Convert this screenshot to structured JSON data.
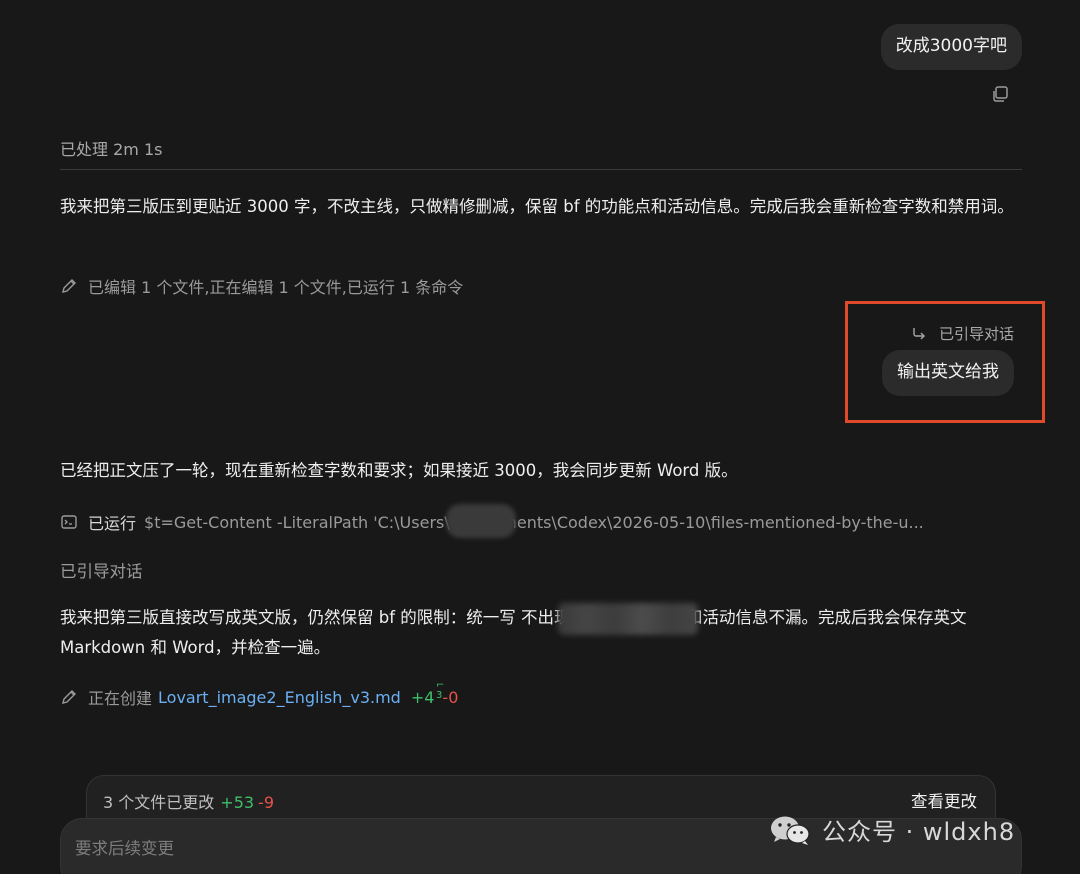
{
  "conversation": {
    "user_message_1": "改成3000字吧",
    "processed_label": "已处理 2m 1s",
    "assistant_para_1": "我来把第三版压到更贴近 3000 字，不改主线，只做精修删减，保留 bf 的功能点和活动信息。完成后我会重新检查字数和禁用词。",
    "activity_1": "已编辑 1 个文件,正在编辑 1 个文件,已运行 1 条命令",
    "steer_tag": "已引导对话",
    "user_message_2": "输出英文给我",
    "assistant_para_2": "已经把正文压了一轮，现在重新检查字数和要求；如果接近 3000，我会同步更新 Word 版。",
    "activity_2_label": "已运行",
    "activity_2_command": "$t=Get-Content -LiteralPath 'C:\\Users\\            \\Documents\\Codex\\2026-05-10\\files-mentioned-by-the-u...",
    "steer_label_2": "已引导对话",
    "assistant_para_3": "我来把第三版直接改写成英文版，仍然保留 bf 的限制：统一写                       不出现禁用词，功能点和活动信息不漏。完成后我会保存英文 Markdown 和 Word，并检查一遍。",
    "activity_3_label": "正在创建",
    "activity_3_file": "Lovart_image2_English_v3.md",
    "activity_3_plus": "+4",
    "activity_3_spin": "⌐\n3",
    "activity_3_minus": "-0"
  },
  "changes_bar": {
    "summary": "3 个文件已更改",
    "plus": "+53",
    "minus": "-9",
    "view_button": "查看更改"
  },
  "composer": {
    "placeholder": "要求后续变更"
  },
  "watermark": {
    "text": "公众号 · wldxh8"
  },
  "icons": {
    "copy": "copy-icon",
    "pencil": "pencil-icon",
    "steer": "steer-arrow-icon",
    "terminal": "terminal-icon",
    "wechat": "wechat-icon"
  },
  "colors": {
    "background": "#181818",
    "bubble": "#2b2b2b",
    "highlight_box": "#e0492a",
    "link": "#6ab0f3",
    "added": "#3fbf6a",
    "removed": "#e5534b"
  }
}
